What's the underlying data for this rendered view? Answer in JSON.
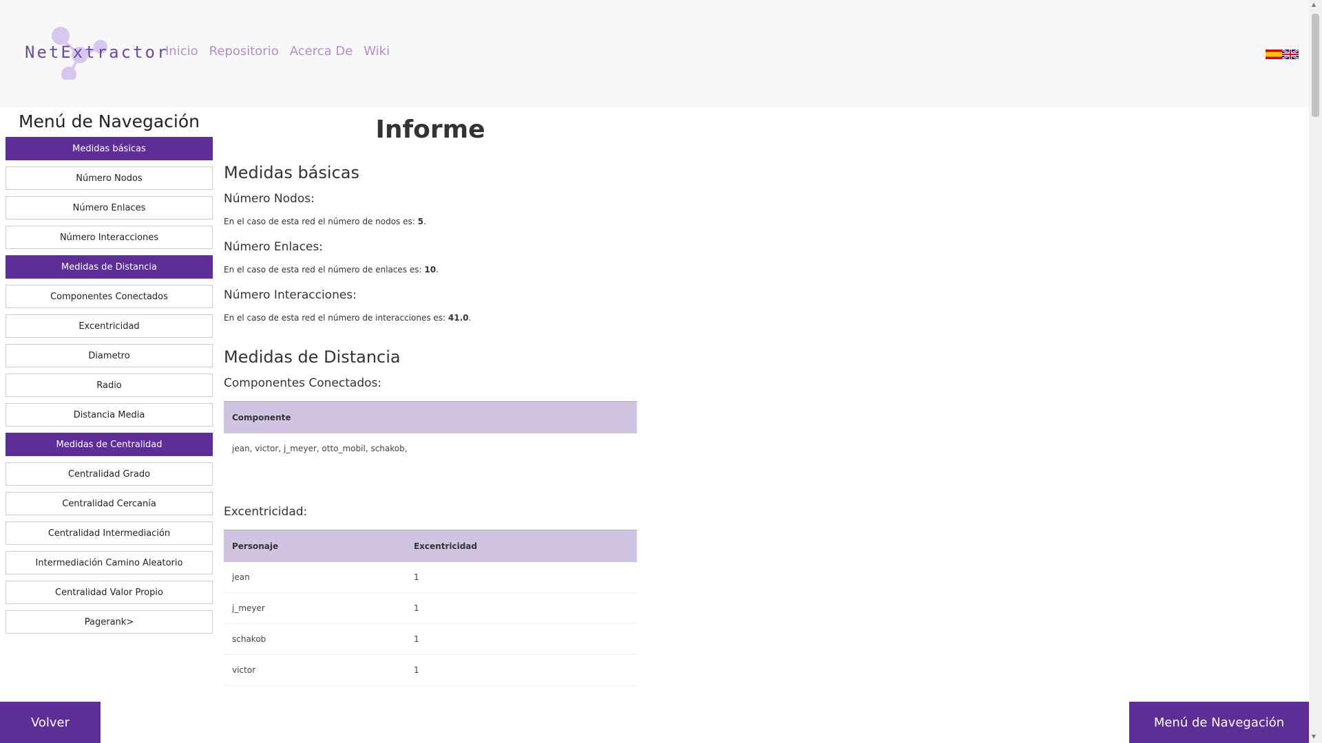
{
  "header": {
    "logo_text": "NetExtractor",
    "nav": [
      "Inicio",
      "Repositorio",
      "Acerca De",
      "Wiki"
    ],
    "flags": [
      "spanish-flag-icon",
      "uk-flag-icon"
    ]
  },
  "sidebar": {
    "title": "Menú de Navegación",
    "items": [
      {
        "label": "Medidas básicas",
        "section": true
      },
      {
        "label": "Número Nodos",
        "section": false
      },
      {
        "label": "Número Enlaces",
        "section": false
      },
      {
        "label": "Número Interacciones",
        "section": false
      },
      {
        "label": "Medidas de Distancia",
        "section": true
      },
      {
        "label": "Componentes Conectados",
        "section": false
      },
      {
        "label": "Excentricidad",
        "section": false
      },
      {
        "label": "Diametro",
        "section": false
      },
      {
        "label": "Radio",
        "section": false
      },
      {
        "label": "Distancia Media",
        "section": false
      },
      {
        "label": "Medidas de Centralidad",
        "section": true
      },
      {
        "label": "Centralidad Grado",
        "section": false
      },
      {
        "label": "Centralidad Cercanía",
        "section": false
      },
      {
        "label": "Centralidad Intermediación",
        "section": false
      },
      {
        "label": "Intermediación Camino Aleatorio",
        "section": false
      },
      {
        "label": "Centralidad Valor Propio",
        "section": false
      },
      {
        "label": "Pagerank>",
        "section": false
      }
    ]
  },
  "main": {
    "title": "Informe",
    "basic": {
      "heading": "Medidas básicas",
      "nodes": {
        "heading": "Número Nodos:",
        "text": "En el caso de esta red el número de nodos es: ",
        "value": "5",
        "suffix": "."
      },
      "links": {
        "heading": "Número Enlaces:",
        "text": "En el caso de esta red el número de enlaces es: ",
        "value": "10",
        "suffix": "."
      },
      "interactions": {
        "heading": "Número Interacciones:",
        "text": "En el caso de esta red el número de interacciones es: ",
        "value": "41.0",
        "suffix": "."
      }
    },
    "distance": {
      "heading": "Medidas de Distancia",
      "components": {
        "heading": "Componentes Conectados:",
        "column": "Componente",
        "value": "jean, victor, j_meyer, otto_mobil, schakob,"
      },
      "eccentricity": {
        "heading": "Excentricidad:",
        "columns": [
          "Personaje",
          "Excentricidad"
        ],
        "rows": [
          [
            "jean",
            "1"
          ],
          [
            "j_meyer",
            "1"
          ],
          [
            "schakob",
            "1"
          ],
          [
            "victor",
            "1"
          ]
        ]
      }
    }
  },
  "footer": {
    "back_label": "Volver",
    "menu_label": "Menú de Navegación"
  },
  "colors": {
    "accent": "#5d2f96",
    "table_header": "#d1c3e2",
    "nav_link": "#b38cc8"
  }
}
